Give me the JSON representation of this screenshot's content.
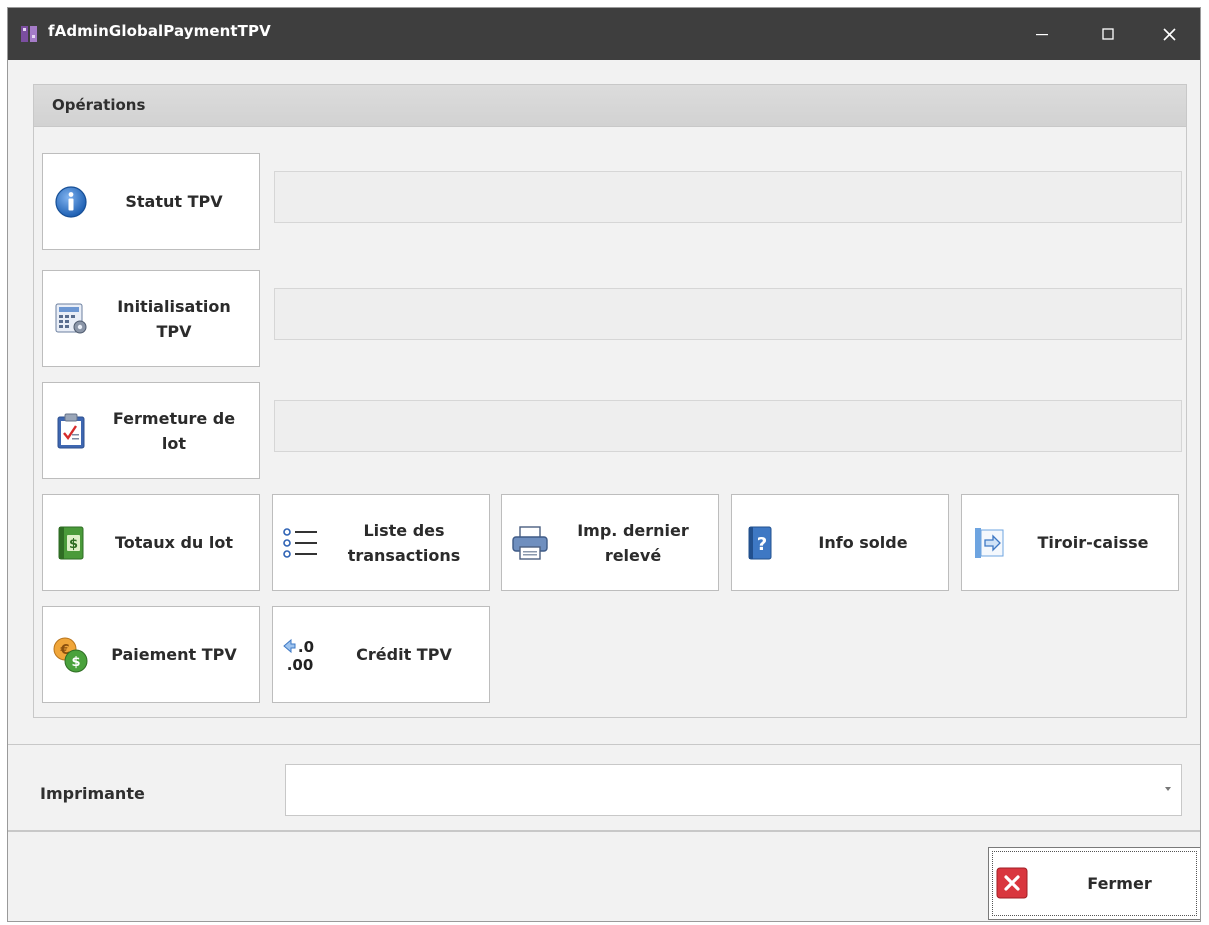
{
  "window": {
    "title": "fAdminGlobalPaymentTPV"
  },
  "operations": {
    "title": "Opérations",
    "buttons": {
      "statut": "Statut TPV",
      "initialisation": "Initialisation\nTPV",
      "fermeture": "Fermeture de\nlot",
      "totaux": "Totaux du lot",
      "liste": "Liste des\ntransactions",
      "imp": "Imp. dernier\nrelevé",
      "info": "Info solde",
      "tiroir": "Tiroir-caisse",
      "paiement": "Paiement TPV",
      "credit": "Crédit TPV"
    },
    "icons": {
      "statut": "info-icon",
      "initialisation": "calculator-gear-icon",
      "fermeture": "clipboard-check-icon",
      "totaux": "dollar-book-icon",
      "liste": "list-icon",
      "imp": "printer-icon",
      "info": "help-book-icon",
      "tiroir": "arrow-right-icon",
      "paiement": "coins-icon",
      "credit": "decimal-icon"
    },
    "fields": {
      "statut_value": "",
      "initialisation_value": "",
      "fermeture_value": ""
    }
  },
  "printer": {
    "label": "Imprimante",
    "selected": ""
  },
  "footer": {
    "close_label": "Fermer"
  },
  "colors": {
    "titlebar": "#3e3e3e",
    "close_icon_red": "#d9363e",
    "info_blue": "#2f6fbf",
    "money_green": "#4aa23c"
  }
}
